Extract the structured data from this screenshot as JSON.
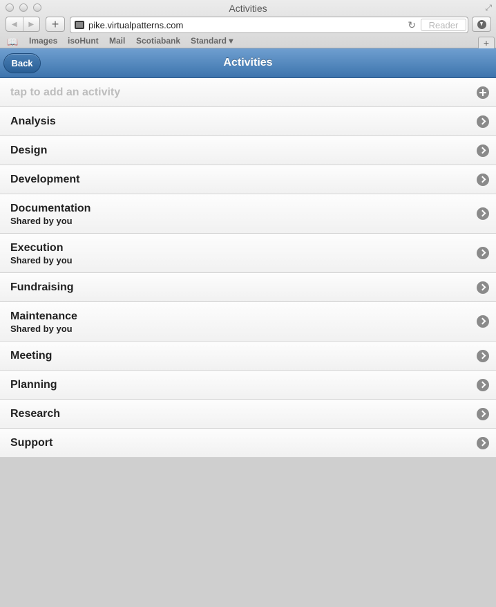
{
  "window": {
    "title": "Activities"
  },
  "toolbar": {
    "url": "pike.virtualpatterns.com",
    "reader_label": "Reader",
    "back_glyph": "◀",
    "forward_glyph": "▶",
    "add_glyph": "+",
    "reload_glyph": "↻"
  },
  "bookmarks": {
    "items": [
      "Images",
      "isoHunt",
      "Mail",
      "Scotiabank",
      "Standard ▾"
    ]
  },
  "app": {
    "back_label": "Back",
    "title": "Activities",
    "accent_color": "#4a7fb5"
  },
  "list": {
    "add_placeholder": "tap to add an activity",
    "items": [
      {
        "title": "Analysis",
        "subtitle": ""
      },
      {
        "title": "Design",
        "subtitle": ""
      },
      {
        "title": "Development",
        "subtitle": ""
      },
      {
        "title": "Documentation",
        "subtitle": "Shared by you"
      },
      {
        "title": "Execution",
        "subtitle": "Shared by you"
      },
      {
        "title": "Fundraising",
        "subtitle": ""
      },
      {
        "title": "Maintenance",
        "subtitle": "Shared by you"
      },
      {
        "title": "Meeting",
        "subtitle": ""
      },
      {
        "title": "Planning",
        "subtitle": ""
      },
      {
        "title": "Research",
        "subtitle": ""
      },
      {
        "title": "Support",
        "subtitle": ""
      }
    ]
  }
}
